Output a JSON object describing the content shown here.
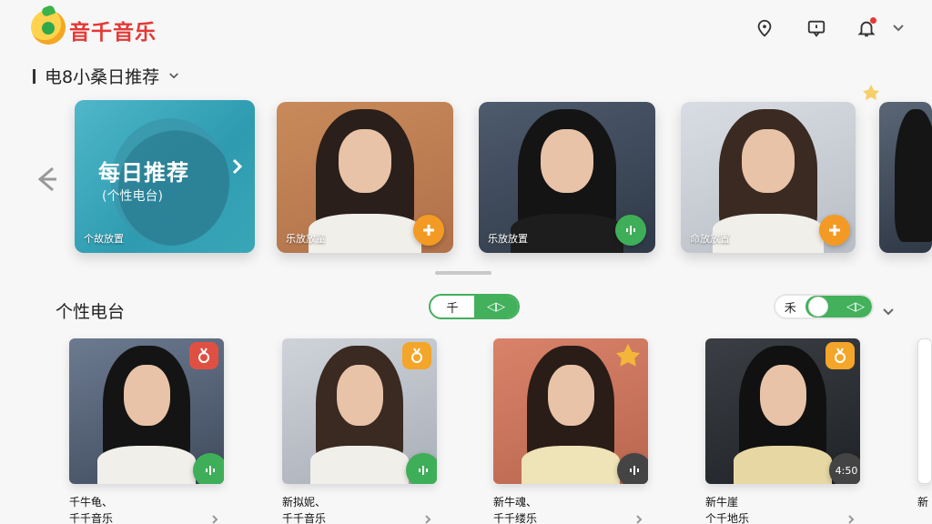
{
  "header": {
    "app_title": "音千音乐",
    "icons": [
      "location-pin-icon",
      "message-icon",
      "bell-icon",
      "chevron-down-icon"
    ]
  },
  "section_recommend": {
    "title": "电8小桑日推荐",
    "daily_card": {
      "title": "每日推荐",
      "subtitle": "(个性电台)",
      "caption": "个故放置"
    },
    "cards": [
      {
        "caption": "乐放放童",
        "action": "add"
      },
      {
        "caption": "乐放放置",
        "action": "play"
      },
      {
        "caption": "命放放置",
        "action": "add"
      }
    ]
  },
  "section_radio": {
    "title": "个性电台",
    "toggle_left": {
      "on_label": "千",
      "off_label": "◁▷"
    },
    "toggle_right": {
      "label": "禾",
      "icon_label": "◁▷"
    },
    "tiles": [
      {
        "title": "千牛龟、",
        "subtitle": "千千音乐",
        "badge": "red",
        "action": "play-green"
      },
      {
        "title": "新拟妮、",
        "subtitle": "千千音乐",
        "badge": "orange",
        "action": "play-green"
      },
      {
        "title": "新牛魂、",
        "subtitle": "千千缕乐",
        "badge": "star",
        "action": "play-dark"
      },
      {
        "title": "新牛崖",
        "subtitle": "个千地乐",
        "badge": "orange",
        "action": "duration",
        "duration": "4:50"
      },
      {
        "title": "新",
        "subtitle": ""
      }
    ]
  },
  "colors": {
    "brand_red": "#e53935",
    "accent_green": "#43b05c",
    "accent_orange": "#f39a24",
    "daily_teal": "#3aa7b8"
  }
}
